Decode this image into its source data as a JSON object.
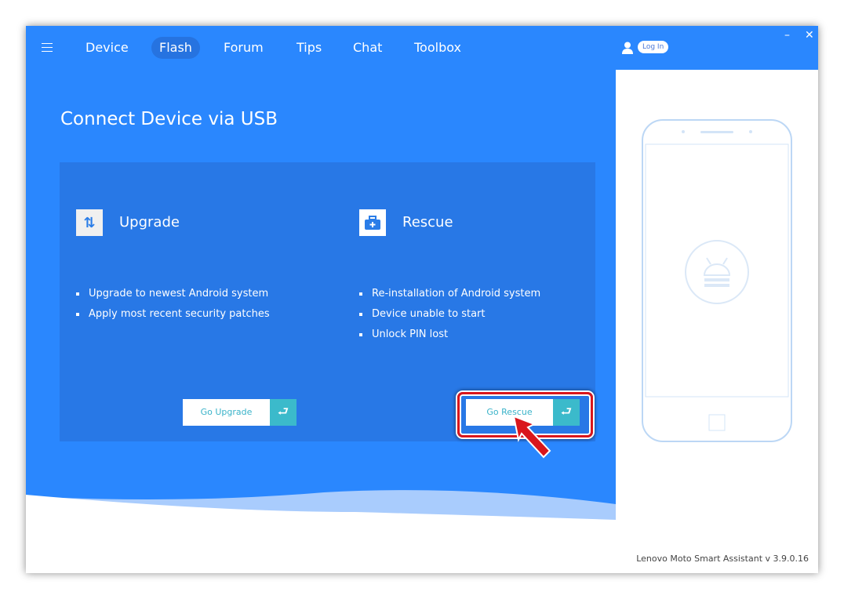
{
  "nav": {
    "items": [
      {
        "label": "Device"
      },
      {
        "label": "Flash",
        "active": true
      },
      {
        "label": "Forum"
      },
      {
        "label": "Tips"
      },
      {
        "label": "Chat"
      },
      {
        "label": "Toolbox"
      }
    ]
  },
  "header": {
    "login_label": "Log In",
    "minimize": "–",
    "close": "✕"
  },
  "main": {
    "title": "Connect Device via USB",
    "upgrade": {
      "heading": "Upgrade",
      "icon": "swap-arrows-icon",
      "bullets": [
        "Upgrade to newest Android system",
        "Apply most recent security patches"
      ],
      "button": "Go Upgrade"
    },
    "rescue": {
      "heading": "Rescue",
      "icon": "toolbox-plus-icon",
      "bullets": [
        "Re-installation of Android system",
        "Device unable to start",
        "Unlock PIN lost"
      ],
      "button": "Go Rescue"
    }
  },
  "footer": {
    "version": "Lenovo Moto Smart Assistant v 3.9.0.16"
  },
  "colors": {
    "background": "#2a87fe",
    "card": "#2878e6",
    "button_accent": "#3bbacb",
    "highlight": "#d9161c"
  }
}
